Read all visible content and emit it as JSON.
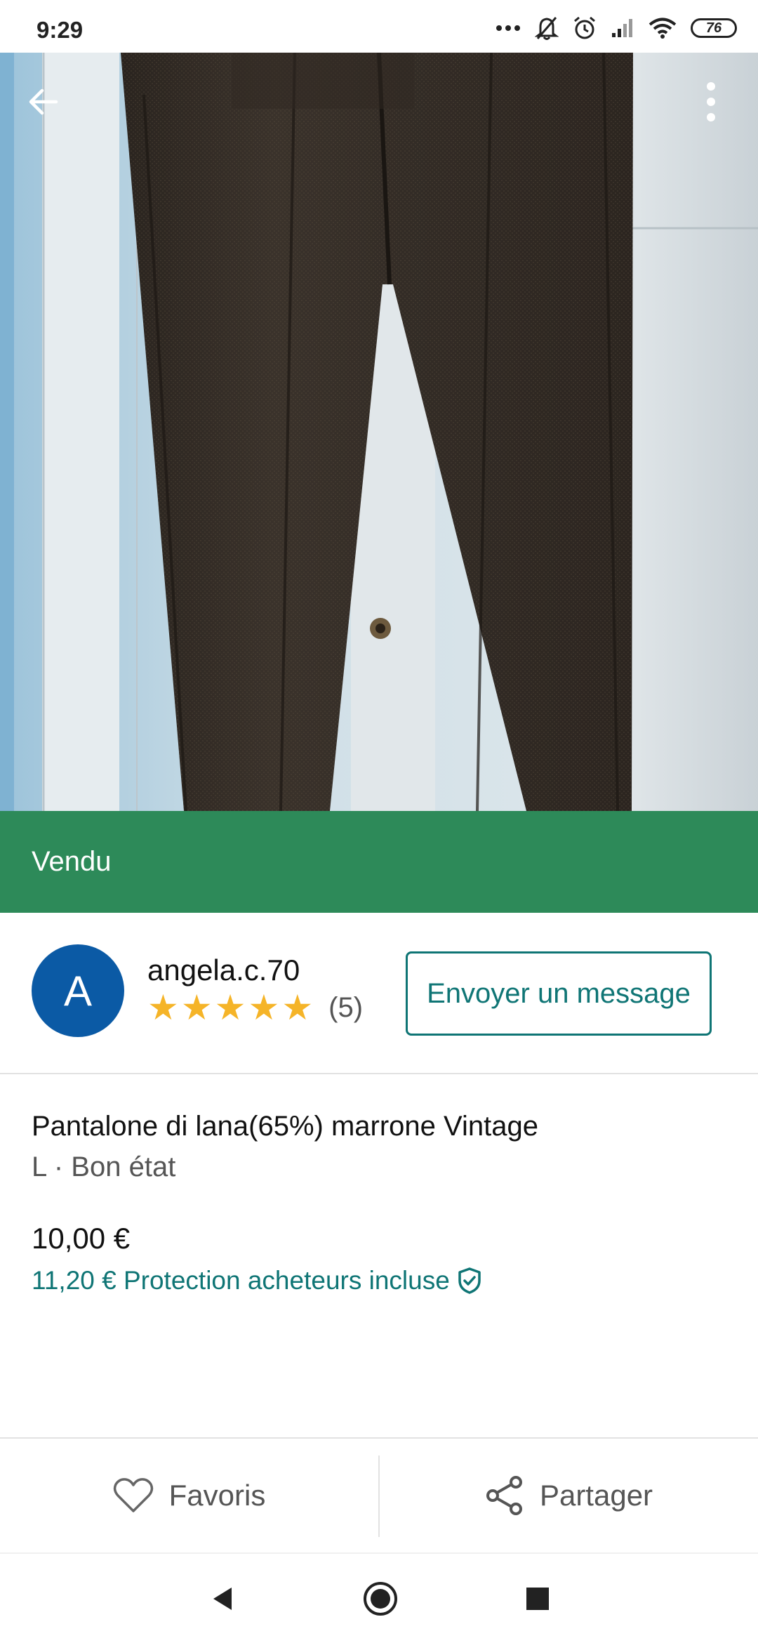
{
  "status_bar": {
    "time": "9:29",
    "battery": "76",
    "icons": [
      "more-dots-icon",
      "bell-off-icon",
      "alarm-icon",
      "signal-icon",
      "wifi-icon",
      "battery-icon"
    ]
  },
  "photo": {
    "page_count": 4,
    "active_index": 0,
    "back_icon": "arrow-left-icon",
    "menu_icon": "more-vertical-icon"
  },
  "sold_banner": {
    "label": "Vendu",
    "color": "#2d8a59"
  },
  "seller": {
    "avatar_letter": "A",
    "avatar_color": "#0b5aa5",
    "name": "angela.c.70",
    "rating_stars": 5,
    "review_count": "(5)",
    "message_button": "Envoyer un message"
  },
  "item": {
    "title": "Pantalone di lana(65%) marrone Vintage",
    "subtitle": "L · Bon état",
    "price": "10,00 €",
    "protection_text": "11,20 € Protection acheteurs incluse",
    "protection_icon": "shield-check-icon"
  },
  "actions": {
    "favorites_label": "Favoris",
    "favorites_icon": "heart-icon",
    "share_label": "Partager",
    "share_icon": "share-icon"
  },
  "navigation": {
    "back_icon": "triangle-back-icon",
    "home_icon": "circle-home-icon",
    "recents_icon": "square-recents-icon"
  },
  "colors": {
    "accent": "#0f7575",
    "star": "#f5b428"
  }
}
